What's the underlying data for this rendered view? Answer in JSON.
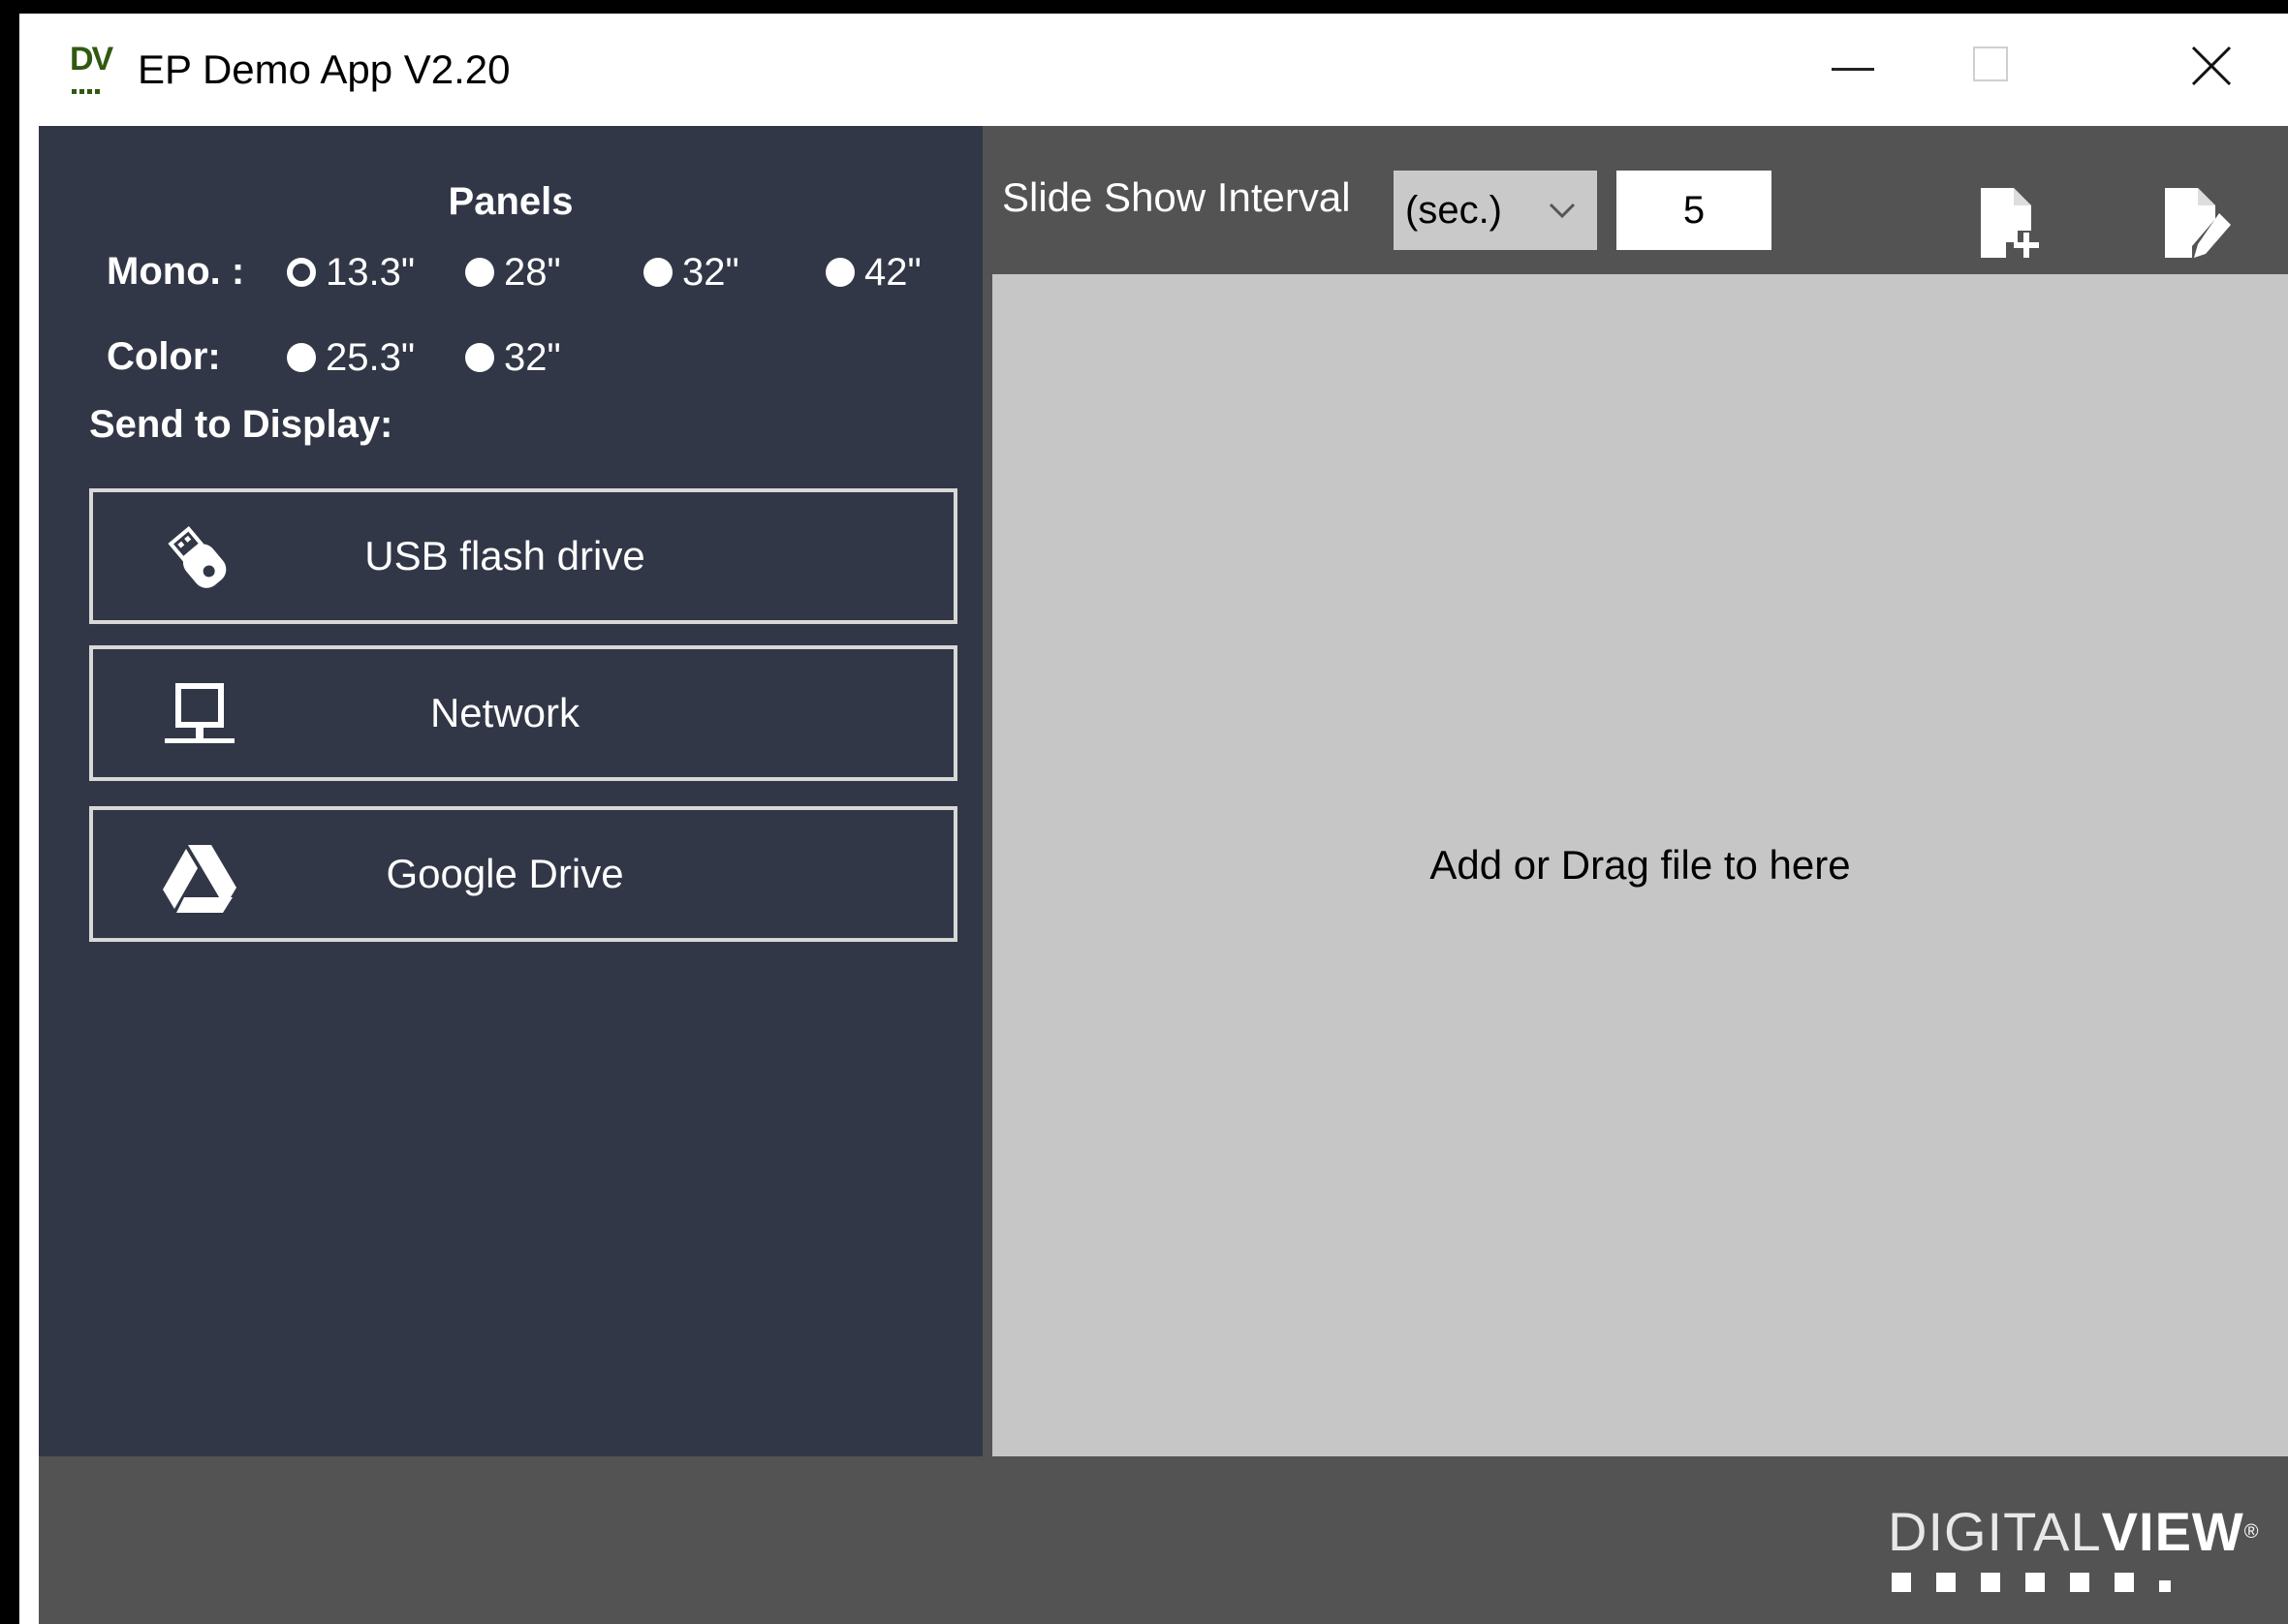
{
  "window": {
    "title": "EP Demo App V2.20",
    "app_icon_text": "DV"
  },
  "left_panel": {
    "panels_heading": "Panels",
    "mono": {
      "label": "Mono. :",
      "options": [
        "13.3\"",
        "28\"",
        "32\"",
        "42\""
      ],
      "selected": "13.3\""
    },
    "color": {
      "label": "Color:",
      "options": [
        "25.3\"",
        "32\""
      ]
    },
    "send_label": "Send to Display:",
    "destinations": [
      {
        "label": "USB flash drive",
        "icon": "usb-drive-icon"
      },
      {
        "label": "Network",
        "icon": "network-computer-icon"
      },
      {
        "label": "Google Drive",
        "icon": "google-drive-icon"
      }
    ]
  },
  "toolbar": {
    "interval_label": "Slide Show Interval",
    "interval_unit": "(sec.)",
    "interval_value": "5",
    "icons": [
      "add-file-icon",
      "edit-file-icon"
    ]
  },
  "dropzone": {
    "text": "Add or Drag file to here"
  },
  "footer": {
    "logo_light": "DIGITAL",
    "logo_bold": "VIEW",
    "logo_reg": "®"
  },
  "colors": {
    "left_panel_bg": "#323747",
    "toolbar_bg": "#535353",
    "dropzone_bg": "#c6c6c6"
  }
}
